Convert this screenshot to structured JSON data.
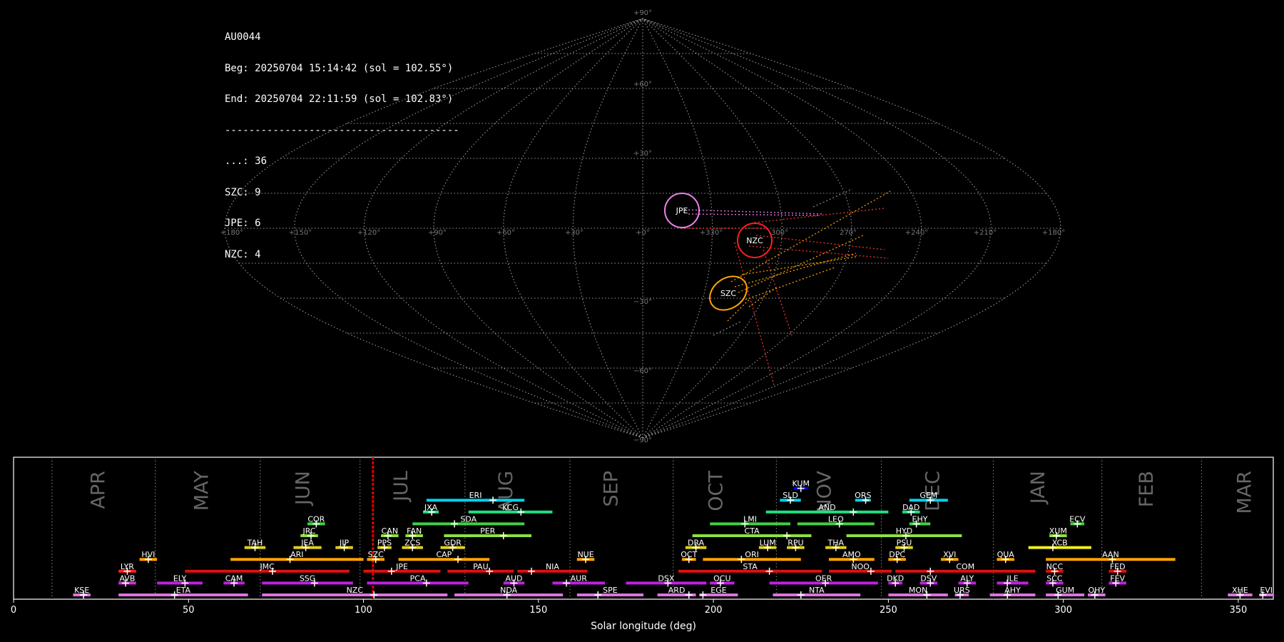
{
  "info": {
    "station": "AU0044",
    "begin": "Beg: 20250704 15:14:42 (sol = 102.55°)",
    "end": "End: 20250704 22:11:59 (sol = 102.83°)",
    "separator": "---------------------------------------",
    "counts": [
      "...: 36",
      "SZC: 9",
      "JPE: 6",
      "NZC: 4"
    ]
  },
  "sky_map": {
    "type": "sinusoidal_projection",
    "grid": true,
    "lat_labels": [
      "+90°",
      "+60°",
      "+30°",
      "−30°",
      "−60°",
      "−90°"
    ],
    "lon_labels": [
      "+180°",
      "+150°",
      "+120°",
      "+90°",
      "+60°",
      "+30°",
      "+0°",
      "+330°",
      "300°",
      "270°",
      "+240°",
      "+210°",
      "+180°"
    ],
    "radiants": [
      {
        "name": "JPE",
        "color": "#ee82ee"
      },
      {
        "name": "NZC",
        "color": "#ff2020"
      },
      {
        "name": "SZC",
        "color": "#ffa500"
      }
    ]
  },
  "chart_data": {
    "type": "timeline",
    "xlabel": "Solar longitude (deg)",
    "xlim": [
      0,
      360
    ],
    "x_ticks": [
      0,
      50,
      100,
      150,
      200,
      250,
      300,
      350
    ],
    "current_sol": 102.7,
    "months": [
      {
        "label": "APR",
        "at": 24.5
      },
      {
        "label": "MAY",
        "at": 54
      },
      {
        "label": "JUN",
        "at": 83
      },
      {
        "label": "JUL",
        "at": 111
      },
      {
        "label": "AUG",
        "at": 141
      },
      {
        "label": "SEP",
        "at": 171
      },
      {
        "label": "OCT",
        "at": 201
      },
      {
        "label": "NOV",
        "at": 232
      },
      {
        "label": "DEC",
        "at": 263
      },
      {
        "label": "JAN",
        "at": 293
      },
      {
        "label": "FEB",
        "at": 324
      },
      {
        "label": "MAR",
        "at": 352
      }
    ],
    "month_boundaries": [
      11,
      40.5,
      70.5,
      99,
      129,
      159,
      188.5,
      218,
      248,
      280,
      311,
      339.5
    ],
    "showers": [
      {
        "name": "KUM",
        "start": 223,
        "end": 227,
        "peak": 225,
        "row": 9,
        "color": "#0000ff"
      },
      {
        "name": "ERI",
        "start": 118,
        "end": 146,
        "peak": 137,
        "row": 8,
        "color": "#00d0f0"
      },
      {
        "name": "SLD",
        "start": 219,
        "end": 225,
        "peak": 222,
        "row": 8,
        "color": "#00d0f0"
      },
      {
        "name": "ORS",
        "start": 240.5,
        "end": 245,
        "peak": 243.5,
        "row": 8,
        "color": "#00d0f0"
      },
      {
        "name": "GEM",
        "start": 256,
        "end": 267,
        "peak": 262,
        "row": 8,
        "color": "#00d0f0"
      },
      {
        "name": "JXA",
        "start": 117,
        "end": 121.5,
        "peak": 119.5,
        "row": 7,
        "color": "#20e080"
      },
      {
        "name": "KCG",
        "start": 130,
        "end": 154,
        "peak": 145,
        "row": 7,
        "color": "#20e080"
      },
      {
        "name": "AND",
        "start": 215,
        "end": 250,
        "peak": 240,
        "row": 7,
        "color": "#20e080"
      },
      {
        "name": "DAD",
        "start": 254,
        "end": 259,
        "peak": 256.5,
        "row": 7,
        "color": "#20e080"
      },
      {
        "name": "COR",
        "start": 84,
        "end": 89,
        "peak": 86.5,
        "row": 6,
        "color": "#40d040"
      },
      {
        "name": "SDA",
        "start": 114,
        "end": 146,
        "peak": 126,
        "row": 6,
        "color": "#40d040"
      },
      {
        "name": "LMI",
        "start": 199,
        "end": 222,
        "peak": 209,
        "row": 6,
        "color": "#40d040"
      },
      {
        "name": "LEO",
        "start": 224,
        "end": 246,
        "peak": 236,
        "row": 6,
        "color": "#40d040"
      },
      {
        "name": "EHY",
        "start": 256,
        "end": 262,
        "peak": 258,
        "row": 6,
        "color": "#40d040"
      },
      {
        "name": "ECV",
        "start": 302,
        "end": 306,
        "peak": 304,
        "row": 6,
        "color": "#40d040"
      },
      {
        "name": "JRC",
        "start": 82,
        "end": 87,
        "peak": 85,
        "row": 5,
        "color": "#90e040"
      },
      {
        "name": "CAN",
        "start": 105,
        "end": 110,
        "peak": 107,
        "row": 5,
        "color": "#90e040"
      },
      {
        "name": "FAN",
        "start": 112,
        "end": 117,
        "peak": 114,
        "row": 5,
        "color": "#90e040"
      },
      {
        "name": "PER",
        "start": 123,
        "end": 148,
        "peak": 140,
        "row": 5,
        "color": "#90e040"
      },
      {
        "name": "CTA",
        "start": 194,
        "end": 228,
        "peak": 221,
        "row": 5,
        "color": "#90e040"
      },
      {
        "name": "HYD",
        "start": 238,
        "end": 271,
        "peak": 255,
        "row": 5,
        "color": "#90e040"
      },
      {
        "name": "XUM",
        "start": 296,
        "end": 301,
        "peak": 298,
        "row": 5,
        "color": "#90e040"
      },
      {
        "name": "TAH",
        "start": 66,
        "end": 72,
        "peak": 69,
        "row": 4,
        "color": "#e0d020"
      },
      {
        "name": "JEA",
        "start": 80,
        "end": 88,
        "peak": 83.5,
        "row": 4,
        "color": "#e0d020"
      },
      {
        "name": "JIP",
        "start": 92,
        "end": 97,
        "peak": 94.5,
        "row": 4,
        "color": "#e0d020"
      },
      {
        "name": "PPS",
        "start": 104,
        "end": 108,
        "peak": 106,
        "row": 4,
        "color": "#e0d020"
      },
      {
        "name": "ZCS",
        "start": 111,
        "end": 117,
        "peak": 114,
        "row": 4,
        "color": "#e0d020"
      },
      {
        "name": "GDR",
        "start": 122,
        "end": 129,
        "peak": 125.5,
        "row": 4,
        "color": "#e0d020"
      },
      {
        "name": "DRA",
        "start": 192,
        "end": 198,
        "peak": 195,
        "row": 4,
        "color": "#e0d020"
      },
      {
        "name": "LUM",
        "start": 213,
        "end": 218,
        "peak": 215.5,
        "row": 4,
        "color": "#e0d020"
      },
      {
        "name": "RPU",
        "start": 221,
        "end": 226,
        "peak": 223.5,
        "row": 4,
        "color": "#e0d020"
      },
      {
        "name": "THA",
        "start": 232,
        "end": 238,
        "peak": 235,
        "row": 4,
        "color": "#e0d020"
      },
      {
        "name": "PSU",
        "start": 252,
        "end": 257,
        "peak": 254.5,
        "row": 4,
        "color": "#e0d020"
      },
      {
        "name": "XCB",
        "start": 290,
        "end": 308,
        "peak": 297,
        "row": 4,
        "color": "#f0f020"
      },
      {
        "name": "HVI",
        "start": 36,
        "end": 41,
        "peak": 38.5,
        "row": 3,
        "color": "#ffa500"
      },
      {
        "name": "ARI",
        "start": 62,
        "end": 100,
        "peak": 79,
        "row": 3,
        "color": "#ffa500"
      },
      {
        "name": "SZC",
        "start": 101,
        "end": 106,
        "peak": 103.5,
        "row": 3,
        "color": "#ffa500"
      },
      {
        "name": "CAP",
        "start": 110,
        "end": 136,
        "peak": 127,
        "row": 3,
        "color": "#ffa500"
      },
      {
        "name": "NUE",
        "start": 161,
        "end": 166,
        "peak": 163.5,
        "row": 3,
        "color": "#ffa500"
      },
      {
        "name": "OCT",
        "start": 191,
        "end": 195,
        "peak": 193,
        "row": 3,
        "color": "#ffa500"
      },
      {
        "name": "ORI",
        "start": 197,
        "end": 225,
        "peak": 208,
        "row": 3,
        "color": "#ffa500"
      },
      {
        "name": "AMO",
        "start": 233,
        "end": 246,
        "peak": 240,
        "row": 3,
        "color": "#ffa500"
      },
      {
        "name": "DPC",
        "start": 250,
        "end": 255,
        "peak": 252.5,
        "row": 3,
        "color": "#ffa500"
      },
      {
        "name": "XVI",
        "start": 265,
        "end": 270,
        "peak": 267.5,
        "row": 3,
        "color": "#ffa500"
      },
      {
        "name": "QUA",
        "start": 281,
        "end": 286,
        "peak": 283.5,
        "row": 3,
        "color": "#ffa500"
      },
      {
        "name": "AAN",
        "start": 295,
        "end": 332,
        "peak": 314,
        "row": 3,
        "color": "#ffa500"
      },
      {
        "name": "LYR",
        "start": 30,
        "end": 35,
        "peak": 32.5,
        "row": 2,
        "color": "#ff2020"
      },
      {
        "name": "JMC",
        "start": 49,
        "end": 96,
        "peak": 74,
        "row": 2,
        "color": "#e01010"
      },
      {
        "name": "JPE",
        "start": 100,
        "end": 122,
        "peak": 108,
        "row": 2,
        "color": "#e01010"
      },
      {
        "name": "PAU",
        "start": 124,
        "end": 143,
        "peak": 136,
        "row": 2,
        "color": "#e01010"
      },
      {
        "name": "NIA",
        "start": 144,
        "end": 164,
        "peak": 148,
        "row": 2,
        "color": "#e01010"
      },
      {
        "name": "STA",
        "start": 190,
        "end": 231,
        "peak": 216,
        "row": 2,
        "color": "#e01010"
      },
      {
        "name": "NOO",
        "start": 233,
        "end": 251,
        "peak": 245,
        "row": 2,
        "color": "#e01010"
      },
      {
        "name": "COM",
        "start": 252,
        "end": 292,
        "peak": 262,
        "row": 2,
        "color": "#e01010"
      },
      {
        "name": "NCC",
        "start": 295,
        "end": 300,
        "peak": 297.5,
        "row": 2,
        "color": "#e01010"
      },
      {
        "name": "FED",
        "start": 313,
        "end": 318,
        "peak": 315.5,
        "row": 2,
        "color": "#e01010"
      },
      {
        "name": "AVB",
        "start": 30,
        "end": 35,
        "peak": 32,
        "row": 1,
        "color": "#d030d0"
      },
      {
        "name": "ELY",
        "start": 41,
        "end": 54,
        "peak": 49,
        "row": 1,
        "color": "#c020e0"
      },
      {
        "name": "CAM",
        "start": 60,
        "end": 66,
        "peak": 63,
        "row": 1,
        "color": "#c020e0"
      },
      {
        "name": "SSG",
        "start": 71,
        "end": 97,
        "peak": 86,
        "row": 1,
        "color": "#c020e0"
      },
      {
        "name": "PCA",
        "start": 101,
        "end": 130,
        "peak": 118,
        "row": 1,
        "color": "#c020e0"
      },
      {
        "name": "AUD",
        "start": 140,
        "end": 146,
        "peak": 143,
        "row": 1,
        "color": "#c020e0"
      },
      {
        "name": "AUR",
        "start": 154,
        "end": 169,
        "peak": 158,
        "row": 1,
        "color": "#c020e0"
      },
      {
        "name": "DSX",
        "start": 175,
        "end": 198,
        "peak": 187,
        "row": 1,
        "color": "#c020e0"
      },
      {
        "name": "OCU",
        "start": 199,
        "end": 206,
        "peak": 202,
        "row": 1,
        "color": "#c020e0"
      },
      {
        "name": "OER",
        "start": 216,
        "end": 247,
        "peak": 232,
        "row": 1,
        "color": "#c020e0"
      },
      {
        "name": "DKD",
        "start": 250,
        "end": 254,
        "peak": 252,
        "row": 1,
        "color": "#c020e0"
      },
      {
        "name": "DSV",
        "start": 259,
        "end": 264,
        "peak": 262,
        "row": 1,
        "color": "#c020e0"
      },
      {
        "name": "ALY",
        "start": 270,
        "end": 275,
        "peak": 272.5,
        "row": 1,
        "color": "#c020e0"
      },
      {
        "name": "ILE",
        "start": 281,
        "end": 290,
        "peak": 284,
        "row": 1,
        "color": "#c020e0"
      },
      {
        "name": "SCC",
        "start": 295,
        "end": 300,
        "peak": 297,
        "row": 1,
        "color": "#c020e0"
      },
      {
        "name": "FEV",
        "start": 313,
        "end": 318,
        "peak": 315,
        "row": 1,
        "color": "#c020e0"
      },
      {
        "name": "KSE",
        "start": 17,
        "end": 22,
        "peak": 20,
        "row": 0,
        "color": "#e070e0"
      },
      {
        "name": "ETA",
        "start": 30,
        "end": 67,
        "peak": 46,
        "row": 0,
        "color": "#e070e0"
      },
      {
        "name": "NZC",
        "start": 71,
        "end": 124,
        "peak": 103,
        "row": 0,
        "color": "#e070e0"
      },
      {
        "name": "NDA",
        "start": 126,
        "end": 157,
        "peak": 141,
        "row": 0,
        "color": "#e070e0"
      },
      {
        "name": "SPE",
        "start": 161,
        "end": 180,
        "peak": 167,
        "row": 0,
        "color": "#e070e0"
      },
      {
        "name": "ARD",
        "start": 184,
        "end": 195,
        "peak": 193,
        "row": 0,
        "color": "#e070e0"
      },
      {
        "name": "EGE",
        "start": 196,
        "end": 207,
        "peak": 197,
        "row": 0,
        "color": "#e070e0"
      },
      {
        "name": "NTA",
        "start": 217,
        "end": 242,
        "peak": 225,
        "row": 0,
        "color": "#e070e0"
      },
      {
        "name": "MON",
        "start": 250,
        "end": 267,
        "peak": 261,
        "row": 0,
        "color": "#e070e0"
      },
      {
        "name": "URS",
        "start": 269,
        "end": 273,
        "peak": 270.5,
        "row": 0,
        "color": "#e070e0"
      },
      {
        "name": "AHY",
        "start": 279,
        "end": 292,
        "peak": 284,
        "row": 0,
        "color": "#e070e0"
      },
      {
        "name": "GUM",
        "start": 295,
        "end": 306,
        "peak": 298.5,
        "row": 0,
        "color": "#e070e0"
      },
      {
        "name": "OHY",
        "start": 307,
        "end": 312,
        "peak": 309,
        "row": 0,
        "color": "#e070e0"
      },
      {
        "name": "XHE",
        "start": 347,
        "end": 354,
        "peak": 350.5,
        "row": 0,
        "color": "#e070e0"
      },
      {
        "name": "EVI",
        "start": 356,
        "end": 360,
        "peak": 357,
        "row": 0,
        "color": "#e070e0"
      }
    ]
  }
}
